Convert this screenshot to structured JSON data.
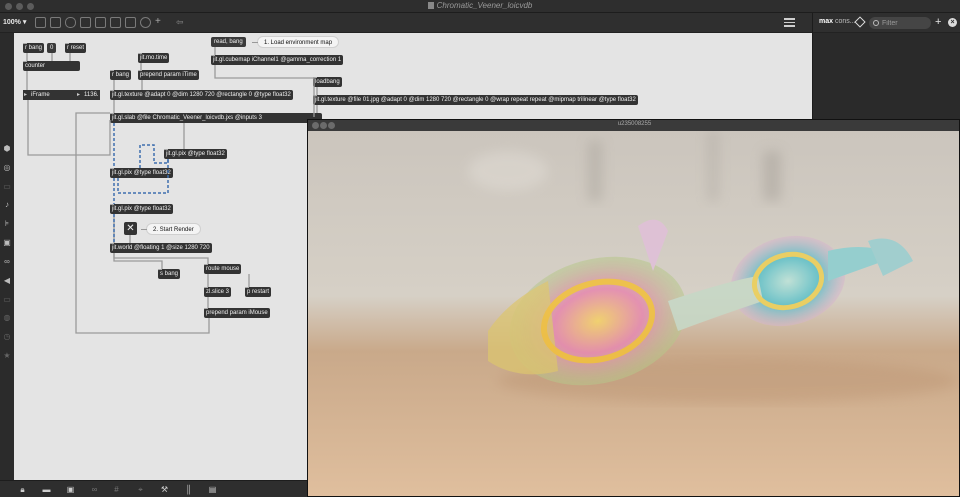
{
  "window": {
    "title": "Chromatic_Veener_loicvdb"
  },
  "toolbar": {
    "zoom": "100%"
  },
  "console": {
    "title_bold": "max",
    "title_rest": "cons...",
    "filter_placeholder": "Filter",
    "add": "+",
    "close": "×"
  },
  "objects": {
    "r_bang": "r bang",
    "zero_msg": "0",
    "r_reset": "r reset",
    "counter": "counter",
    "iframe": "iFrame",
    "iframe_value": "1136.",
    "jit_mo_time": "jit.mo.time",
    "r_bang2": "r bang",
    "prepend_itime": "prepend param iTime",
    "read_bang": "read, bang",
    "cubemap": "jit.gl.cubemap iChannel1 @gamma_correction 1",
    "loadbang": "loadbang",
    "texture_adapt": "jit.gl.texture @adapt 0 @dim 1280 720 @rectangle 0 @type float32",
    "texture_file": "jit.gl.texture @file 01.jpg @adapt 0 @dim 1280 720 @rectangle 0 @wrap repeat repeat @mipmap trilinear @type float32",
    "slab": "jit.gl.slab @file Chromatic_Veener_loicvdb.jxs @inputs 3",
    "pix_right": "jit.gl.pix @type float32",
    "pix_mid": "jit.gl.pix @type float32",
    "pix_bottom": "jit.gl.pix @type float32",
    "world": "jit.world @floating 1 @size 1280 720",
    "s_bang": "s bang",
    "route_mouse": "route mouse",
    "zl_slice": "zl.slice 3",
    "p_restart": "p restart",
    "prepend_imouse": "prepend param iMouse"
  },
  "comments": {
    "load_env": "1. Load environment map",
    "start_render": "2. Start Render"
  },
  "render_window": {
    "title": "u235008255"
  }
}
